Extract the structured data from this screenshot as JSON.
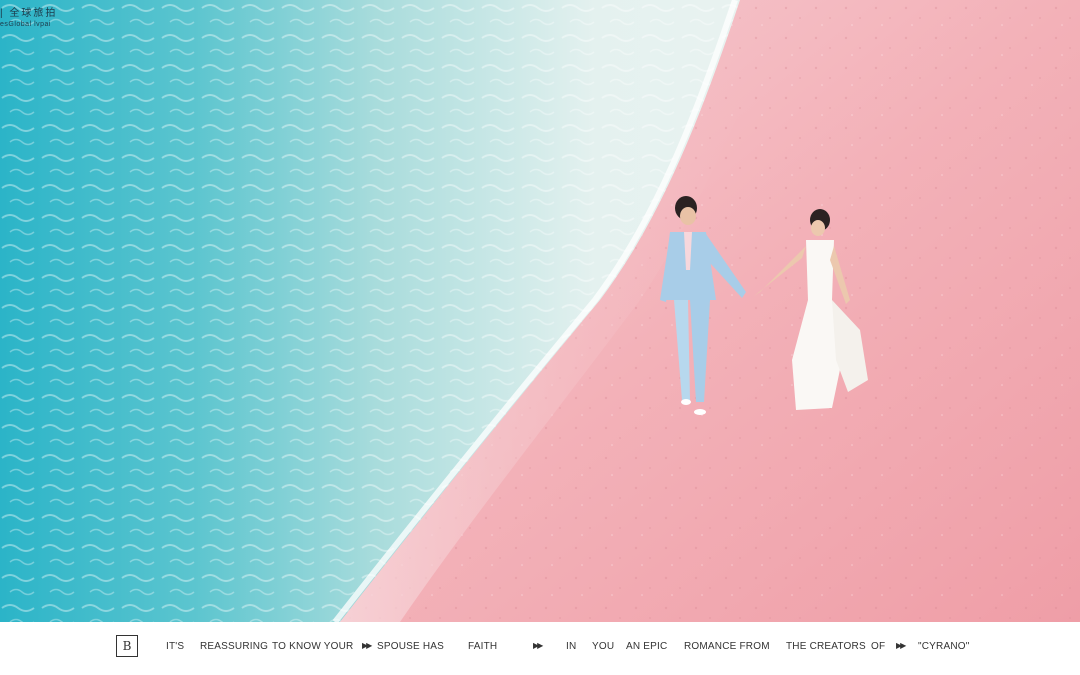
{
  "watermark": {
    "line1": "| 全球旅拍",
    "line2": "esGlobal lvpai"
  },
  "colors": {
    "sea_deep": "#2bb4c8",
    "sea_mid": "#8dd3d8",
    "foam": "#eef4f3",
    "sand": "#f2a8b0",
    "sand_light": "#f7c5c8",
    "suit": "#a8cde8",
    "dress": "#faf8f5"
  },
  "footer": {
    "logo": "B",
    "items": [
      "IT'S",
      "REASSURING",
      "TO KNOW YOUR",
      "SPOUSE HAS",
      "FAITH",
      "IN",
      "YOU",
      "AN EPIC",
      "ROMANCE FROM",
      "THE CREATORS",
      "OF",
      "\"CYRANO\""
    ],
    "arrow_icon": "double-chevron-right-icon"
  }
}
